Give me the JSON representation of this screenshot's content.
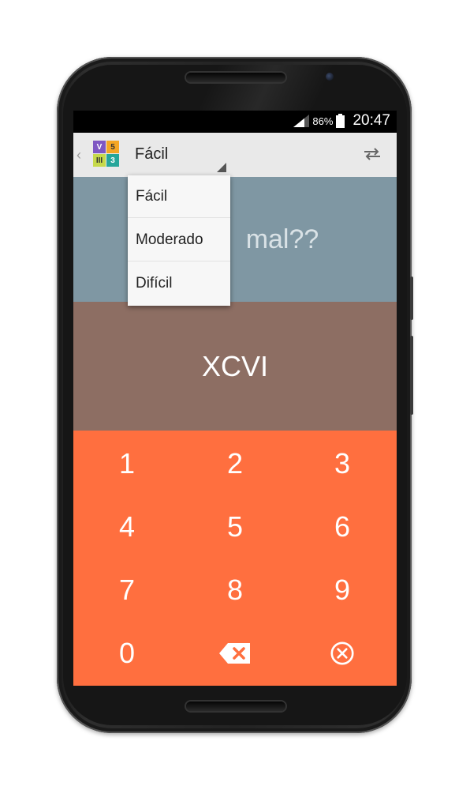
{
  "status_bar": {
    "battery_percent": "86%",
    "time": "20:47"
  },
  "action_bar": {
    "logo": {
      "cells": [
        "V",
        "5",
        "III",
        "3"
      ]
    },
    "difficulty_selected": "Fácil",
    "icons": {
      "back": "chevron-left-icon",
      "swap": "swap-icon"
    }
  },
  "question": {
    "text": "mal??"
  },
  "answer": {
    "roman": "XCVI"
  },
  "keypad": {
    "keys": [
      "1",
      "2",
      "3",
      "4",
      "5",
      "6",
      "7",
      "8",
      "9",
      "0"
    ],
    "backspace_icon": "backspace-icon",
    "clear_icon": "clear-circle-icon"
  },
  "dropdown": {
    "options": [
      "Fácil",
      "Moderado",
      "Difícil"
    ]
  },
  "colors": {
    "question_bg": "#7f97a3",
    "answer_bg": "#8d6e63",
    "keypad_bg": "#ff6f3f",
    "action_bar_bg": "#e9e9e9"
  }
}
